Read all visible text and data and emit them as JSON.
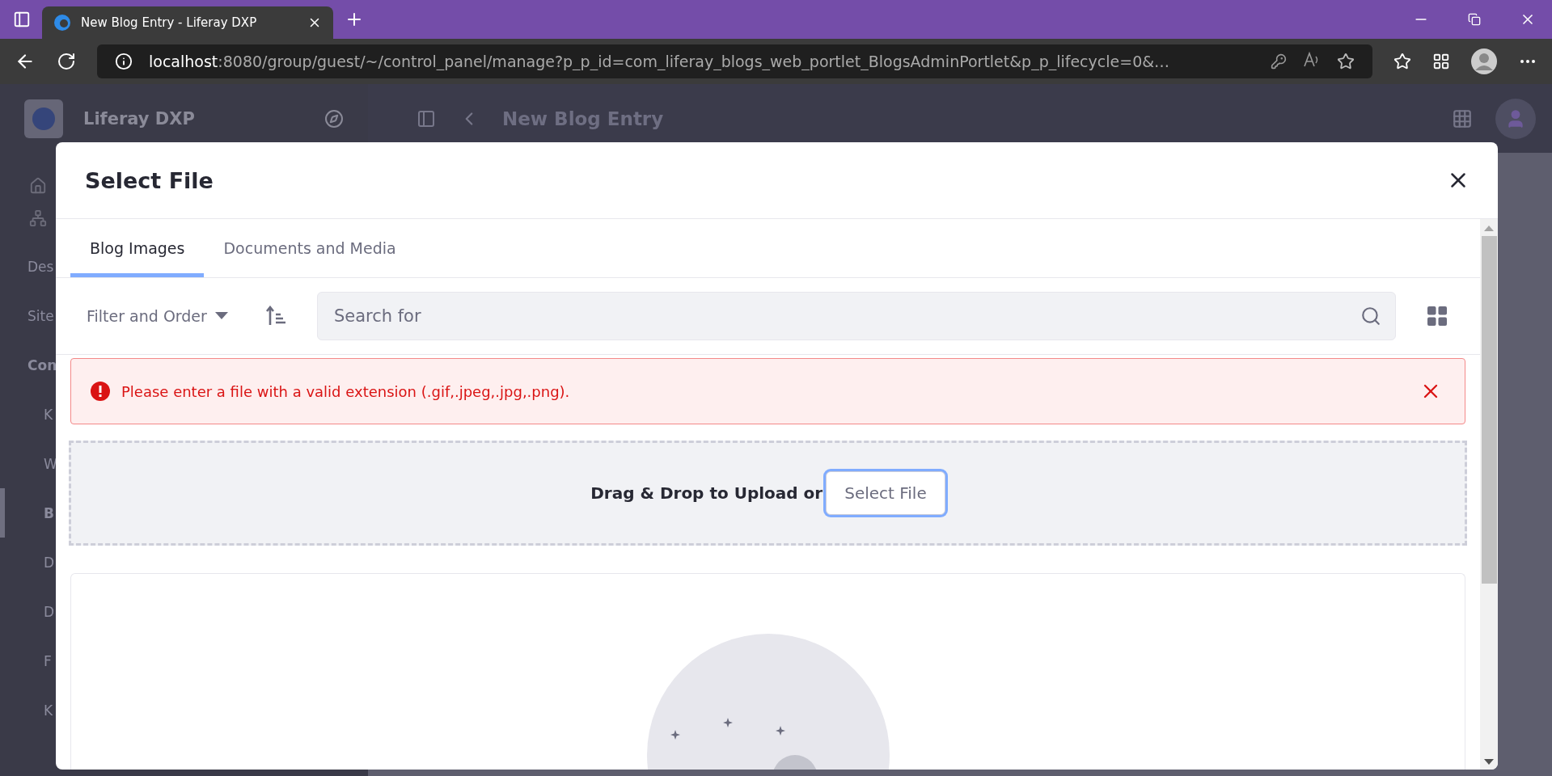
{
  "browser": {
    "tab_title": "New Blog Entry - Liferay DXP",
    "url_host": "localhost",
    "url_rest": ":8080/group/guest/~/control_panel/manage?p_p_id=com_liferay_blogs_web_portlet_BlogsAdminPortlet&p_p_lifecycle=0&…"
  },
  "sidebar": {
    "brand": "Liferay DXP",
    "items": [
      {
        "label": "Des",
        "kind": "section",
        "selected": false
      },
      {
        "label": "Site",
        "kind": "section",
        "selected": false
      },
      {
        "label": "Con",
        "kind": "group",
        "selected": false
      },
      {
        "label": "K",
        "kind": "item",
        "selected": false
      },
      {
        "label": "W",
        "kind": "item",
        "selected": false
      },
      {
        "label": "B",
        "kind": "item",
        "selected": true
      },
      {
        "label": "D",
        "kind": "item",
        "selected": false
      },
      {
        "label": "D",
        "kind": "item",
        "selected": false
      },
      {
        "label": "F",
        "kind": "item",
        "selected": false
      },
      {
        "label": "K",
        "kind": "item",
        "selected": false
      }
    ]
  },
  "header": {
    "title": "New Blog Entry"
  },
  "modal": {
    "title": "Select File",
    "tabs": [
      {
        "label": "Blog Images",
        "selected": true
      },
      {
        "label": "Documents and Media",
        "selected": false
      }
    ],
    "filter": "Filter and Order",
    "search": {
      "placeholder": "Search for"
    },
    "alert": "Please enter a file with a valid extension (.gif,.jpeg,.jpg,.png).",
    "dropzone": {
      "text": "Drag & Drop to Upload or",
      "button": "Select File"
    }
  }
}
